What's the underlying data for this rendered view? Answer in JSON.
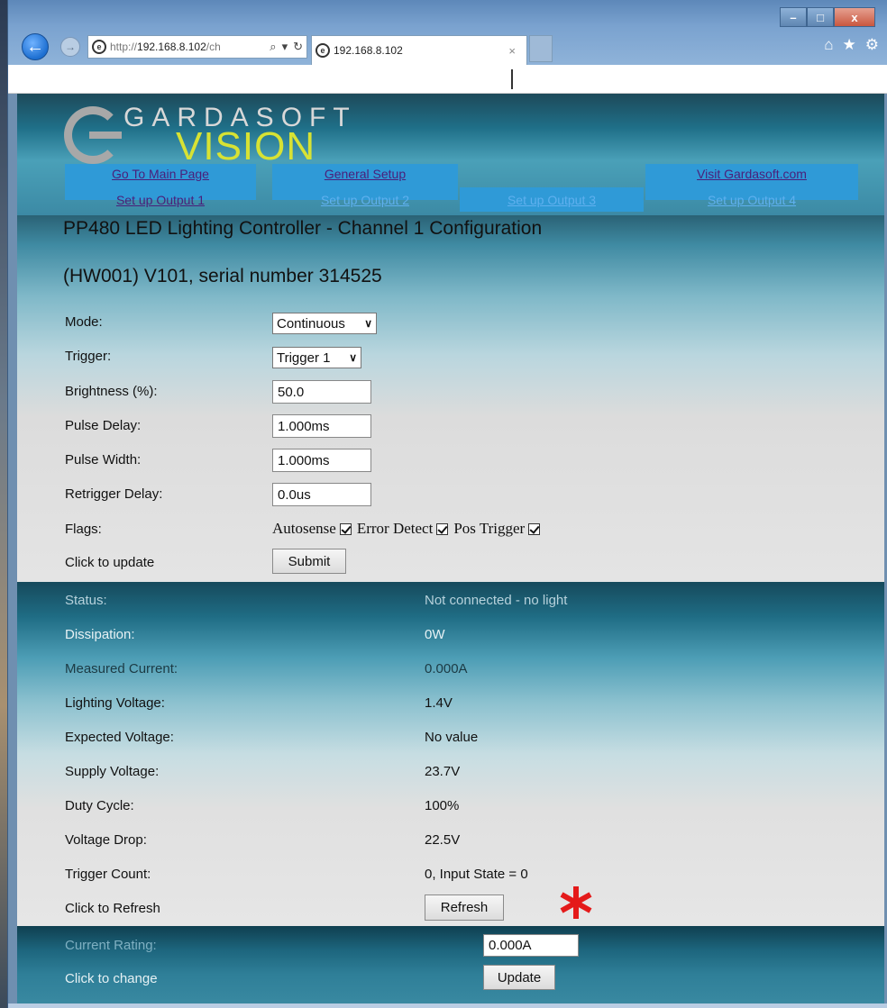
{
  "browser": {
    "url_prefix": "http://",
    "url_host": "192.168.8.102",
    "url_path": "/ch",
    "tab_title": "192.168.8.102",
    "window_controls": {
      "minimize": "–",
      "maximize": "□",
      "close": "x"
    }
  },
  "header": {
    "logo_line1": "GARDASOFT",
    "logo_line2": "VISION",
    "nav": {
      "main": "Go To Main Page",
      "general": "General Setup",
      "visit": "Visit Gardasoft.com",
      "output1": "Set up Output 1",
      "output2": "Set up Output 2",
      "output3": "Set up Output 3",
      "output4": "Set up Output 4"
    }
  },
  "config": {
    "title": "PP480 LED Lighting Controller - Channel 1 Configuration",
    "serial": "(HW001) V101, serial number 314525",
    "mode_label": "Mode:",
    "mode_value": "Continuous",
    "trigger_label": "Trigger:",
    "trigger_value": "Trigger 1",
    "brightness_label": "Brightness (%):",
    "brightness_value": "50.0",
    "pulse_delay_label": "Pulse Delay:",
    "pulse_delay_value": "1.000ms",
    "pulse_width_label": "Pulse Width:",
    "pulse_width_value": "1.000ms",
    "retrigger_label": "Retrigger Delay:",
    "retrigger_value": "0.0us",
    "flags_label": "Flags:",
    "flag_autosense": "Autosense",
    "flag_error": "Error Detect",
    "flag_pos": "Pos Trigger",
    "update_label": "Click to update",
    "submit": "Submit"
  },
  "status": {
    "rows": [
      {
        "label": "Status:",
        "value": "Not connected - no light"
      },
      {
        "label": "Dissipation:",
        "value": "0W"
      },
      {
        "label": "Measured Current:",
        "value": "0.000A"
      },
      {
        "label": "Lighting Voltage:",
        "value": "1.4V"
      },
      {
        "label": "Expected Voltage:",
        "value": "No value"
      },
      {
        "label": "Supply Voltage:",
        "value": "23.7V"
      },
      {
        "label": "Duty Cycle:",
        "value": "100%"
      },
      {
        "label": "Voltage Drop:",
        "value": "22.5V"
      },
      {
        "label": "Trigger Count:",
        "value": "0, Input State = 0"
      }
    ],
    "refresh_label": "Click to Refresh",
    "refresh": "Refresh"
  },
  "rating": {
    "label": "Current Rating:",
    "value": "0.000A",
    "change_label": "Click to change",
    "update": "Update"
  },
  "colors": {
    "accent_nav": "#2f9ad7",
    "logo_yellow": "#d7e234",
    "asterisk": "#e41a1a"
  }
}
